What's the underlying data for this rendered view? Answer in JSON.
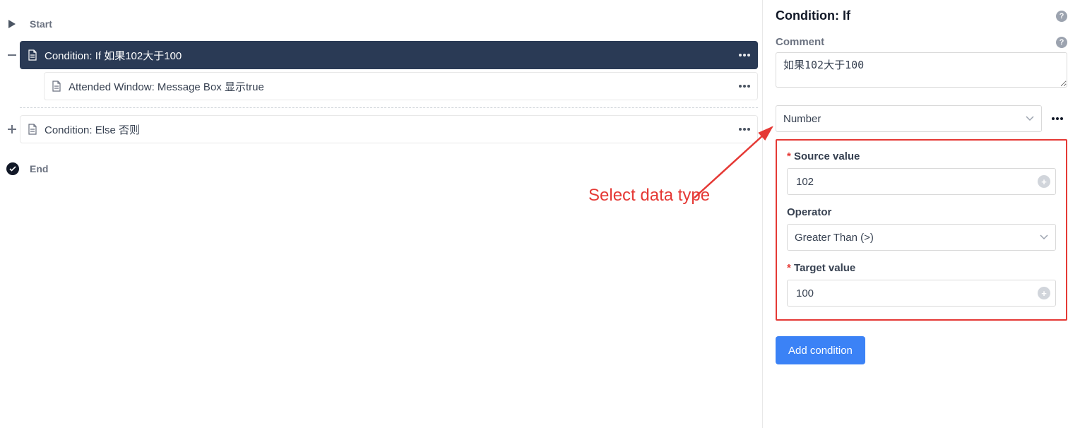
{
  "annotation": {
    "text": "Select data type"
  },
  "tree": {
    "start_label": "Start",
    "condition_if_label": "Condition: If 如果102大于100",
    "message_box_label": "Attended Window: Message Box 显示true",
    "condition_else_label": "Condition: Else 否则",
    "end_label": "End"
  },
  "panel": {
    "title": "Condition: If",
    "comment_label": "Comment",
    "comment_value": "如果102大于100",
    "data_type": {
      "selected": "Number"
    },
    "source": {
      "label": "Source value",
      "value": "102"
    },
    "operator": {
      "label": "Operator",
      "selected": "Greater Than (>)"
    },
    "target": {
      "label": "Target value",
      "value": "100"
    },
    "add_button": "Add condition"
  }
}
